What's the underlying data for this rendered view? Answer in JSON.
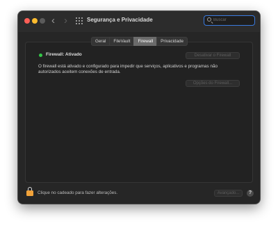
{
  "window": {
    "title": "Segurança e Privacidade",
    "nav_back": "‹",
    "nav_forward": "›"
  },
  "search": {
    "placeholder": "Buscar",
    "value": ""
  },
  "tabs": [
    {
      "label": "Geral",
      "active": false
    },
    {
      "label": "FileVault",
      "active": false
    },
    {
      "label": "Firewall",
      "active": true
    },
    {
      "label": "Privacidade",
      "active": false
    }
  ],
  "firewall": {
    "status": "Firewall: Ativado",
    "status_color": "#33c748",
    "deactivate_button": "Desativar o Firewall",
    "description_lines": [
      "O firewall está ativado e configurado para impedir que serviços, aplicativos e programas não",
      "autorizados aceitem conexões de entrada."
    ],
    "options_button": "Opções do Firewall..."
  },
  "footer": {
    "lock_hint": "Clique no cadeado para fazer alterações.",
    "advanced_button": "Avançado...",
    "help": "?"
  }
}
